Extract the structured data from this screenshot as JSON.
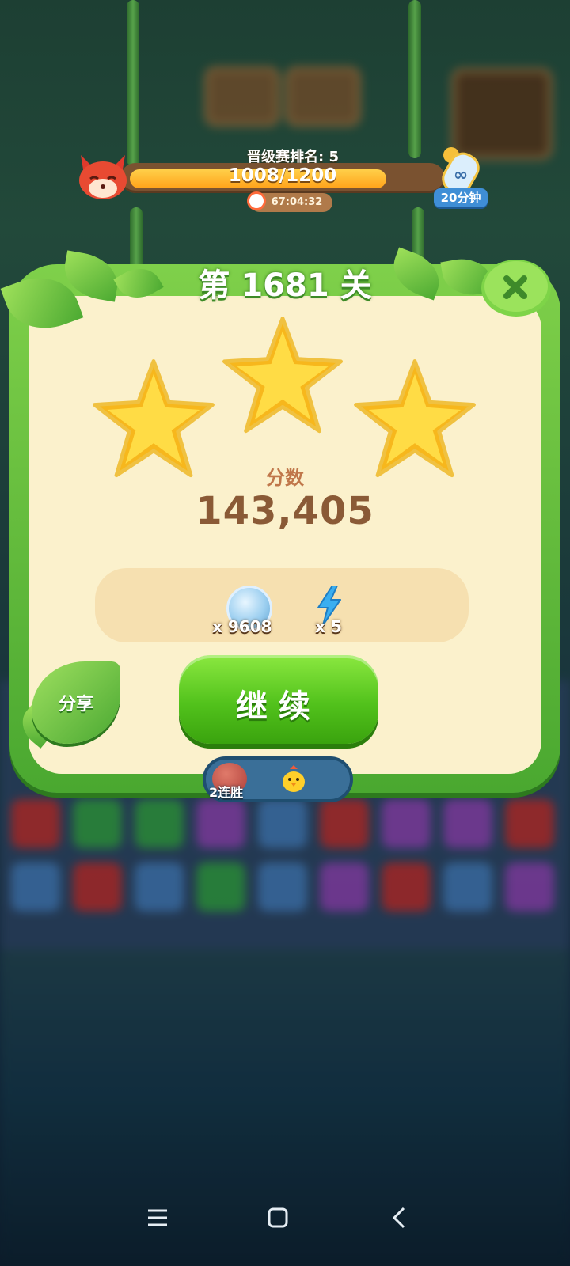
{
  "progress": {
    "rank_label": "晋级赛排名: 5",
    "score_text": "1008/1200",
    "current": 1008,
    "target": 1200,
    "timer": "67:04:32",
    "bottle_label": "20分钟"
  },
  "level": {
    "title": "第 1681 关",
    "stars_earned": 3,
    "stars_total": 3,
    "score_label": "分数",
    "score_value": "143,405"
  },
  "rewards": {
    "coin_count": "x 9608",
    "energy_count": "x 5"
  },
  "buttons": {
    "share": "分享",
    "continue": "继续"
  },
  "streak": {
    "label": "2连胜"
  },
  "colors": {
    "panel_green": "#5bb836",
    "panel_cream": "#fbf1cc",
    "score_brown": "#8a5a36",
    "continue_green": "#52c21c"
  },
  "icons": {
    "avatar": "fox-avatar-icon",
    "booster": "infinity-bottle-icon",
    "timer": "clock-icon",
    "close": "close-icon",
    "coin": "leaf-coin-icon",
    "energy": "lightning-icon",
    "streak": "boxing-glove-icon",
    "chick": "chick-icon"
  }
}
